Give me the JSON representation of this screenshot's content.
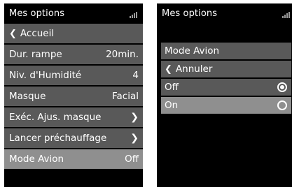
{
  "left_screen": {
    "title": "Mes options",
    "items": [
      {
        "label": "Accueil",
        "value": "",
        "chevron_left": true,
        "chevron_right": false,
        "selected": false
      },
      {
        "label": "Dur. rampe",
        "value": "20min.",
        "chevron_left": false,
        "chevron_right": false,
        "selected": false
      },
      {
        "label": "Niv. d'Humidité",
        "value": "4",
        "chevron_left": false,
        "chevron_right": false,
        "selected": false
      },
      {
        "label": "Masque",
        "value": "Facial",
        "chevron_left": false,
        "chevron_right": false,
        "selected": false
      },
      {
        "label": "Exéc. Ajus. masque",
        "value": "",
        "chevron_left": false,
        "chevron_right": true,
        "selected": false
      },
      {
        "label": "Lancer préchauffage",
        "value": "",
        "chevron_left": false,
        "chevron_right": true,
        "selected": false
      },
      {
        "label": "Mode Avion",
        "value": "Off",
        "chevron_left": false,
        "chevron_right": false,
        "selected": true
      }
    ]
  },
  "right_screen": {
    "title": "Mes options",
    "header": "Mode Avion",
    "back_label": "Annuler",
    "options": [
      {
        "label": "Off",
        "checked": true,
        "selected": false
      },
      {
        "label": "On",
        "checked": false,
        "selected": true
      }
    ]
  },
  "icons": {
    "signal": "signal-strength-icon",
    "back": "chevron-left-icon",
    "forward": "chevron-right-icon",
    "radio": "radio-button-icon"
  },
  "colors": {
    "background": "#000000",
    "row": "#595959",
    "row_selected": "#8f8f8f",
    "text": "#ffffff"
  }
}
